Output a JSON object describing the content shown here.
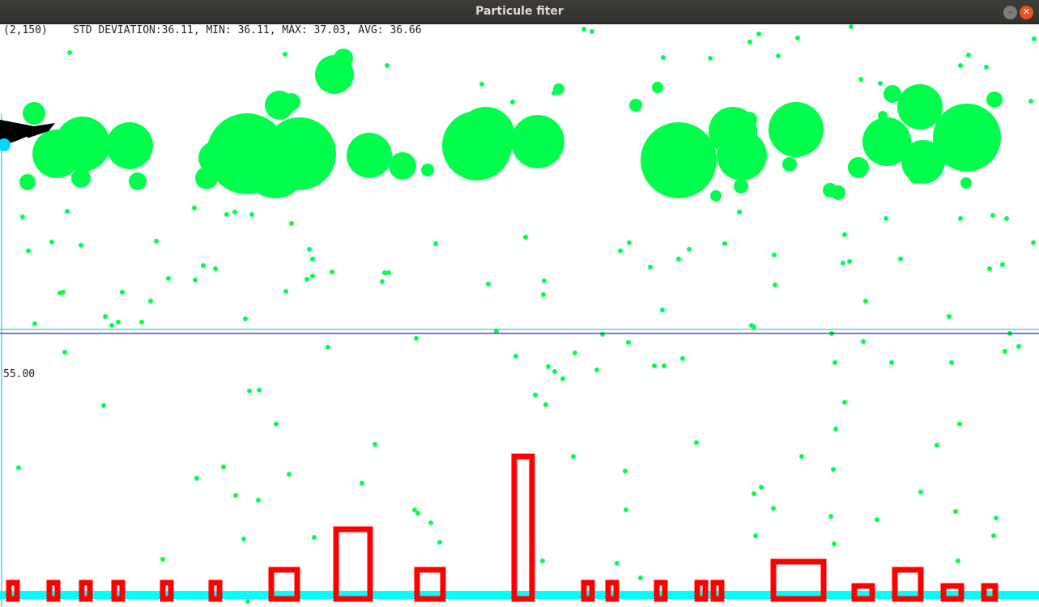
{
  "window": {
    "title": "Particule fiter",
    "minimize_glyph": "–",
    "close_glyph": "✕"
  },
  "status": {
    "cursor": "(2,150)",
    "stats": "STD DEVIATION:36.11, MIN: 36.11, MAX: 37.03, AVG: 36.66"
  },
  "histogram": {
    "scale_label": "55.00"
  },
  "colors": {
    "particle": "#00ff4c",
    "histogram_bar": "#ff0000",
    "baseline": "#00ffff",
    "sensor_line": "#00c8a0",
    "divider": "#3a1fd0",
    "robot": "#000000",
    "robot_marker": "#00d8ff"
  }
}
